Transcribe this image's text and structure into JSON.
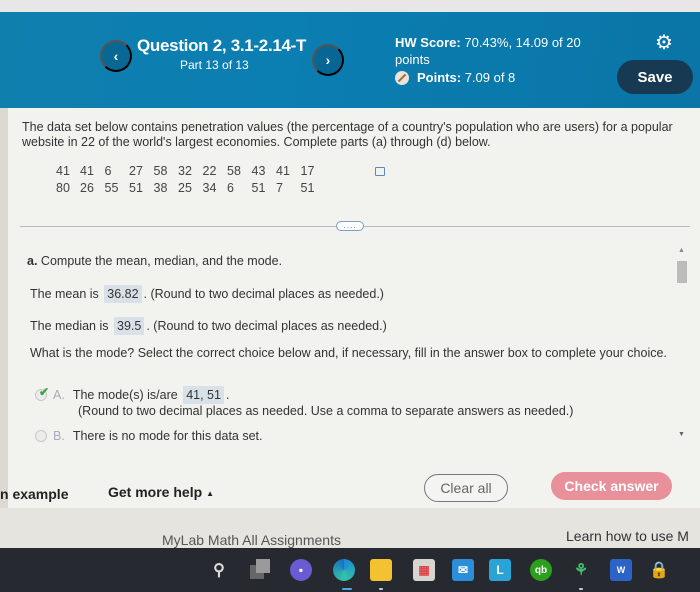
{
  "header": {
    "question_title": "Question 2, 3.1-2.14-T",
    "question_part": "Part 13 of 13",
    "hw_score_label": "HW Score:",
    "hw_score_value": "70.43%, 14.09 of 20 points",
    "points_label": "Points:",
    "points_value": "7.09 of 8",
    "save_label": "Save",
    "prev_glyph": "‹",
    "next_glyph": "›",
    "settings_glyph": "⚙"
  },
  "problem": {
    "intro": "The data set below contains penetration values (the percentage of a country's population who are users) for a popular website in 22 of the world's largest economies. Complete parts (a) through (d) below.",
    "data_row_1": [
      "41",
      "41",
      "6",
      "27",
      "58",
      "32",
      "22",
      "58",
      "43",
      "41",
      "17"
    ],
    "data_row_2": [
      "80",
      "26",
      "55",
      "51",
      "38",
      "25",
      "34",
      "6",
      "51",
      "7",
      "51"
    ],
    "expander_label": "...."
  },
  "part_a": {
    "heading_letter": "a.",
    "heading_text": "Compute the mean, median, and the mode.",
    "mean_prefix": "The mean is",
    "mean_value": "36.82",
    "mean_suffix": ". (Round to two decimal places as needed.)",
    "median_prefix": "The median is",
    "median_value": "39.5",
    "median_suffix": ". (Round to two decimal places as needed.)",
    "mode_question": "What is the mode? Select the correct choice below and, if necessary, fill in the answer box to complete your choice.",
    "choices": [
      {
        "letter": "A.",
        "prefix": "The mode(s) is/are",
        "value": "41, 51",
        "suffix": ".",
        "note": "(Round to two decimal places as needed. Use a comma to separate answers as needed.)",
        "selected": true,
        "correct": true
      },
      {
        "letter": "B.",
        "text": "There is no mode for this data set.",
        "selected": false
      }
    ]
  },
  "footer": {
    "example_label": "n example",
    "help_label": "Get more help",
    "help_caret": "▲",
    "clear_label": "Clear all",
    "check_label": "Check answer"
  },
  "browser": {
    "bookmark_1": "MyLab Math All Assignments",
    "bookmark_2": "Learn how to use M"
  },
  "taskbar": {
    "icons": [
      "windows-start",
      "search",
      "task-view",
      "teams",
      "edge",
      "file-explorer",
      "microsoft-store",
      "mail",
      "l-app",
      "quickbooks",
      "dragon",
      "word",
      "security"
    ],
    "l_label": "L",
    "qb_label": "qb",
    "word_label": "W"
  },
  "colors": {
    "header_bg": "#0b7eb2",
    "save_bg": "#173a52",
    "check_answer_bg": "#e8919b",
    "answer_box_bg": "#d9e1e8",
    "correct_check": "#3aa53a"
  }
}
